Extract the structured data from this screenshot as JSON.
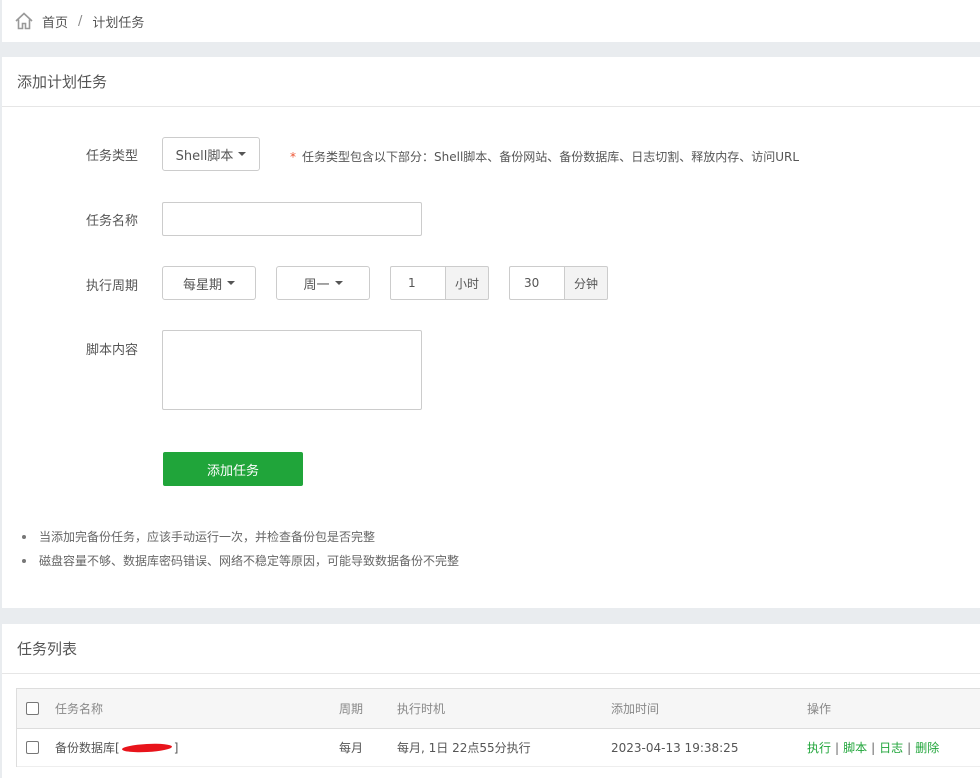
{
  "breadcrumb": {
    "home": "首页",
    "sep": "/",
    "current": "计划任务"
  },
  "add_panel": {
    "title": "添加计划任务",
    "task_type": {
      "label": "任务类型",
      "value": "Shell脚本",
      "note": "任务类型包含以下部分：Shell脚本、备份网站、备份数据库、日志切割、释放内存、访问URL",
      "note_star": "*"
    },
    "task_name": {
      "label": "任务名称",
      "value": ""
    },
    "period": {
      "label": "执行周期",
      "cycle": "每星期",
      "weekday": "周一",
      "hour": "1",
      "hour_unit": "小时",
      "minute": "30",
      "minute_unit": "分钟"
    },
    "script": {
      "label": "脚本内容",
      "value": ""
    },
    "submit_label": "添加任务",
    "tips": [
      "当添加完备份任务，应该手动运行一次，并检查备份包是否完整",
      "磁盘容量不够、数据库密码错误、网络不稳定等原因，可能导致数据备份不完整"
    ]
  },
  "list_panel": {
    "title": "任务列表",
    "columns": {
      "name": "任务名称",
      "period": "周期",
      "exec_time": "执行时机",
      "added": "添加时间",
      "ops": "操作"
    },
    "rows": [
      {
        "name_prefix": "备份数据库[",
        "name_suffix": "]",
        "period": "每月",
        "exec_time": "每月, 1日 22点55分执行",
        "added": "2023-04-13 19:38:25",
        "ops": {
          "run": "执行",
          "script": "脚本",
          "log": "日志",
          "delete": "删除",
          "sep": "|"
        }
      }
    ]
  },
  "colors": {
    "accent": "#20a53a",
    "redaction": "#e8141b"
  }
}
